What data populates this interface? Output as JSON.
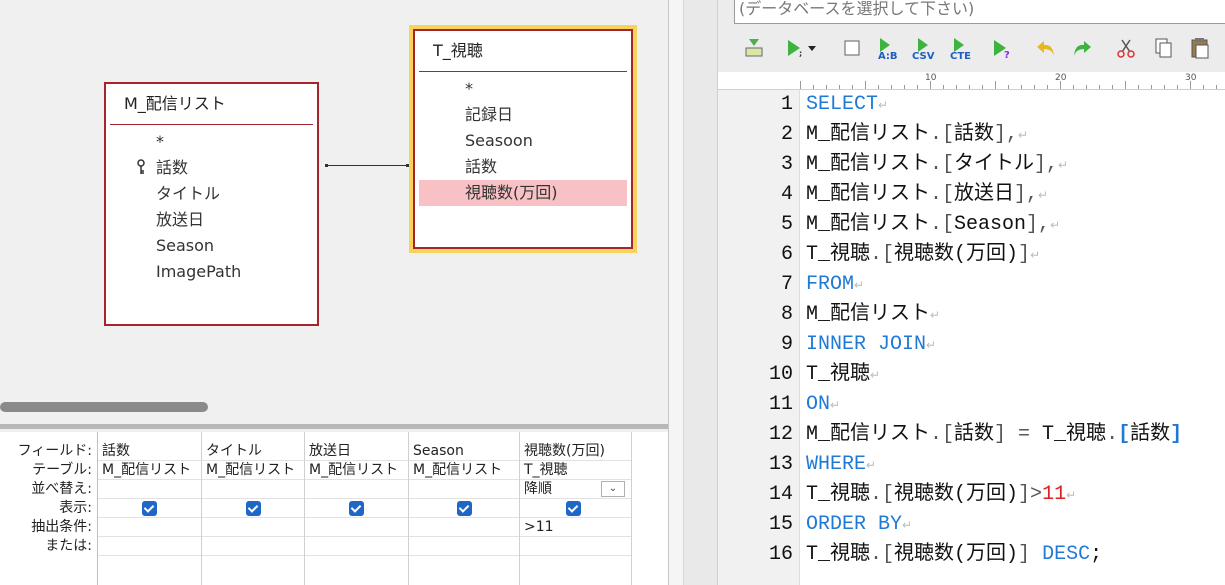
{
  "designer": {
    "table1": {
      "title": "M_配信リスト",
      "fields": [
        "*",
        "話数",
        "タイトル",
        "放送日",
        "Season",
        "ImagePath"
      ]
    },
    "table2": {
      "title": "T_視聴",
      "fields": [
        "*",
        "記録日",
        "Seasoon",
        "話数",
        "視聴数(万回)"
      ]
    },
    "grid": {
      "row_labels": [
        "フィールド:",
        "テーブル:",
        "並べ替え:",
        "表示:",
        "抽出条件:",
        "または:"
      ],
      "columns": [
        {
          "field": "話数",
          "table": "M_配信リスト",
          "sort": "",
          "show": true,
          "criteria": ""
        },
        {
          "field": "タイトル",
          "table": "M_配信リスト",
          "sort": "",
          "show": true,
          "criteria": ""
        },
        {
          "field": "放送日",
          "table": "M_配信リスト",
          "sort": "",
          "show": true,
          "criteria": ""
        },
        {
          "field": "Season",
          "table": "M_配信リスト",
          "sort": "",
          "show": true,
          "criteria": ""
        },
        {
          "field": "視聴数(万回)",
          "table": "T_視聴",
          "sort": "降順",
          "show": true,
          "criteria": ">11"
        }
      ]
    }
  },
  "editor": {
    "db_placeholder": "(データベースを選択して下さい)",
    "toolbar": {
      "ab_label": "A:B",
      "csv_label": "CSV",
      "cte_label": "CTE"
    },
    "ruler": {
      "labels": [
        "10",
        "20",
        "30"
      ]
    },
    "line_numbers": [
      "1",
      "2",
      "3",
      "4",
      "5",
      "6",
      "7",
      "8",
      "9",
      "10",
      "11",
      "12",
      "13",
      "14",
      "15",
      "16"
    ],
    "code": {
      "l1": "SELECT",
      "l2a": "M_配信リスト",
      "l2b": ".[",
      "l2c": "話数",
      "l2d": "],",
      "l3a": "M_配信リスト",
      "l3b": ".[",
      "l3c": "タイトル",
      "l3d": "],",
      "l4a": "M_配信リスト",
      "l4b": ".[",
      "l4c": "放送日",
      "l4d": "],",
      "l5a": "M_配信リスト",
      "l5b": ".[",
      "l5c": "Season",
      "l5d": "],",
      "l6a": "T_視聴",
      "l6b": ".[",
      "l6c": "視聴数(万回)",
      "l6d": "]",
      "l7": "FROM",
      "l8": "M_配信リスト",
      "l9": "INNER JOIN",
      "l10": "T_視聴",
      "l11": "ON",
      "l12a": "M_配信リスト",
      "l12b": ".[",
      "l12c": "話数",
      "l12d": "] = ",
      "l12e": "T_視聴",
      "l12f": ".",
      "l12g": "[",
      "l12h": "話数",
      "l12i": "]",
      "l13": "WHERE",
      "l14a": "T_視聴",
      "l14b": ".[",
      "l14c": "視聴数(万回)",
      "l14d": "]>",
      "l14e": "11",
      "l15": "ORDER BY",
      "l16a": "T_視聴",
      "l16b": ".[",
      "l16c": "視聴数(万回)",
      "l16d": "] ",
      "l16e": "DESC",
      "l16f": ";"
    },
    "eol_mark": "↵"
  }
}
